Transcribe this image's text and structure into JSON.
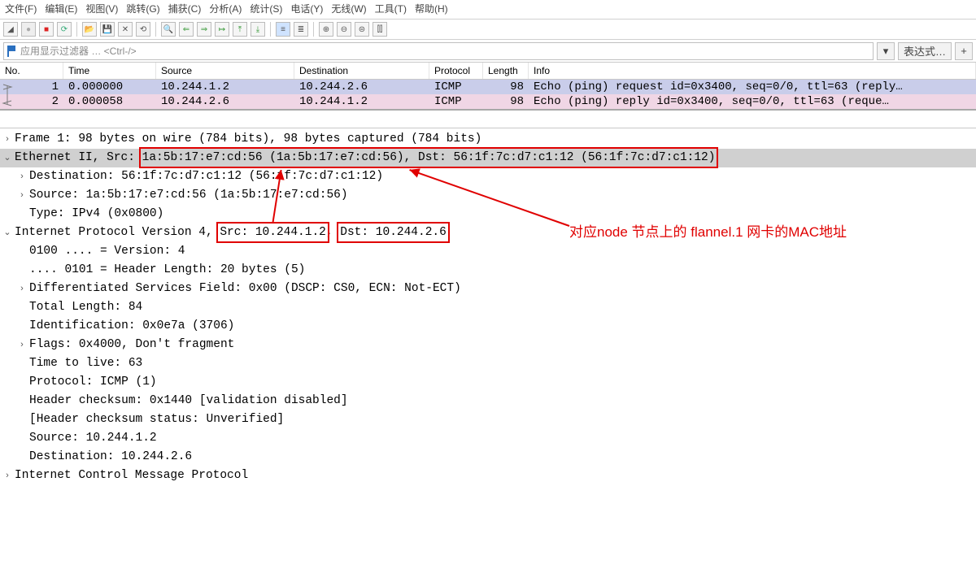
{
  "menu": {
    "file": "文件(F)",
    "edit": "编辑(E)",
    "view": "视图(V)",
    "goto": "跳转(G)",
    "capture": "捕获(C)",
    "analyze": "分析(A)",
    "stats": "统计(S)",
    "telephony": "电话(Y)",
    "wireless": "无线(W)",
    "tools": "工具(T)",
    "help": "帮助(H)"
  },
  "filter": {
    "placeholder": "应用显示过滤器 … <Ctrl-/>",
    "expr_btn": "表达式…",
    "plus": "+"
  },
  "columns": {
    "no": "No.",
    "time": "Time",
    "source": "Source",
    "dest": "Destination",
    "proto": "Protocol",
    "len": "Length",
    "info": "Info"
  },
  "packets": [
    {
      "no": "1",
      "time": "0.000000",
      "src": "10.244.1.2",
      "dst": "10.244.2.6",
      "proto": "ICMP",
      "len": "98",
      "info": "Echo (ping) request  id=0x3400, seq=0/0, ttl=63 (reply…"
    },
    {
      "no": "2",
      "time": "0.000058",
      "src": "10.244.2.6",
      "dst": "10.244.1.2",
      "proto": "ICMP",
      "len": "98",
      "info": "Echo (ping) reply    id=0x3400, seq=0/0, ttl=63 (reque…"
    }
  ],
  "tree": {
    "frame": "Frame 1: 98 bytes on wire (784 bits), 98 bytes captured (784 bits)",
    "eth_pref": "Ethernet II, Src: ",
    "eth_boxed": "1a:5b:17:e7:cd:56 (1a:5b:17:e7:cd:56), Dst: 56:1f:7c:d7:c1:12 (56:1f:7c:d7:c1:12)",
    "eth_dst": "Destination: 56:1f:7c:d7:c1:12 (56:1f:7c:d7:c1:12)",
    "eth_src": "Source: 1a:5b:17:e7:cd:56 (1a:5b:17:e7:cd:56)",
    "eth_type": "Type: IPv4 (0x0800)",
    "ip_pref": "Internet Protocol Version 4, ",
    "ip_src": "Src: 10.244.1.2",
    "ip_sep": ", ",
    "ip_dst": "Dst: 10.244.2.6",
    "ip_ver": "0100 .... = Version: 4",
    "ip_hlen": ".... 0101 = Header Length: 20 bytes (5)",
    "ip_dsf": "Differentiated Services Field: 0x00 (DSCP: CS0, ECN: Not-ECT)",
    "ip_tlen": "Total Length: 84",
    "ip_id": "Identification: 0x0e7a (3706)",
    "ip_flags": "Flags: 0x4000, Don't fragment",
    "ip_ttl": "Time to live: 63",
    "ip_proto": "Protocol: ICMP (1)",
    "ip_hchk": "Header checksum: 0x1440 [validation disabled]",
    "ip_hchks": "[Header checksum status: Unverified]",
    "ip_srcf": "Source: 10.244.1.2",
    "ip_dstf": "Destination: 10.244.2.6",
    "icmp": "Internet Control Message Protocol"
  },
  "annotation": {
    "text": "对应node 节点上的 flannel.1 网卡的MAC地址"
  }
}
